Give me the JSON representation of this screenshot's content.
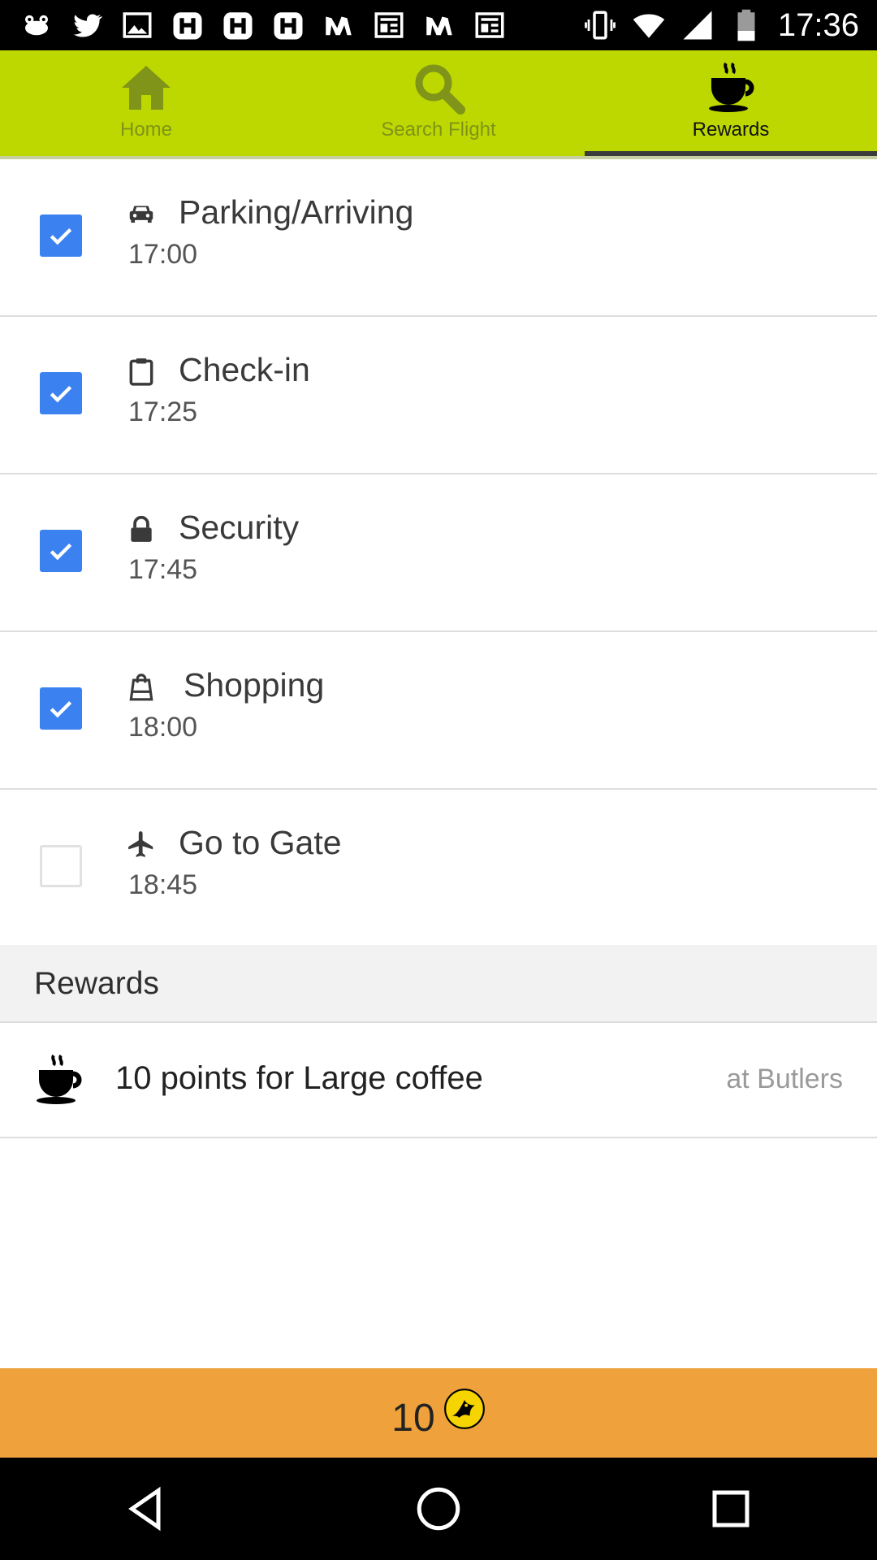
{
  "status_bar": {
    "time": "17:36",
    "left_icons": [
      "frog-icon",
      "twitter-icon",
      "image-icon",
      "h-app-icon",
      "h-app-icon",
      "h-app-icon",
      "m-app-icon",
      "newspaper-icon",
      "m-app-icon",
      "newspaper-icon"
    ],
    "right_icons": [
      "vibrate-icon",
      "wifi-icon",
      "cell-signal-icon",
      "battery-icon"
    ]
  },
  "tabs": [
    {
      "label": "Home",
      "icon": "home-icon",
      "active": false
    },
    {
      "label": "Search Flight",
      "icon": "search-icon",
      "active": false
    },
    {
      "label": "Rewards",
      "icon": "coffee-icon",
      "active": true
    }
  ],
  "steps": [
    {
      "title": "Parking/Arriving",
      "time": "17:00",
      "icon": "car-icon",
      "checked": true
    },
    {
      "title": "Check-in",
      "time": "17:25",
      "icon": "clipboard-icon",
      "checked": true
    },
    {
      "title": "Security",
      "time": "17:45",
      "icon": "lock-icon",
      "checked": true
    },
    {
      "title": "Shopping",
      "time": "18:00",
      "icon": "shopping-bag-icon",
      "checked": true
    },
    {
      "title": "Go to Gate",
      "time": "18:45",
      "icon": "airplane-icon",
      "checked": false
    }
  ],
  "rewards": {
    "header": "Rewards",
    "items": [
      {
        "text": "10 points for Large coffee",
        "place": "at Butlers",
        "icon": "coffee-icon"
      }
    ]
  },
  "points": {
    "value": "10",
    "badge_icon": "bird-badge-icon"
  },
  "nav": [
    "back-icon",
    "home-circle-icon",
    "recents-icon"
  ],
  "colors": {
    "tab_bar": "#bdd800",
    "checkbox": "#3b82f0",
    "points_bar": "#efa23c"
  }
}
